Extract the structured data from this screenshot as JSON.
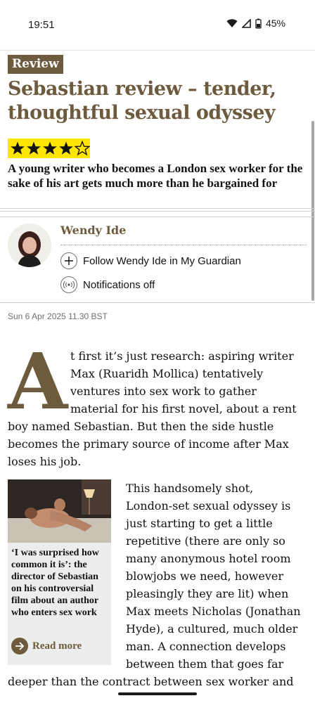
{
  "status_bar": {
    "time": "19:51",
    "battery": "45%"
  },
  "article": {
    "kicker": "Review",
    "headline": "Sebastian review – tender, thoughtful sexual odyssey",
    "rating": {
      "stars": 4,
      "out_of": 5
    },
    "standfirst": "A young writer who becomes a London sex worker for the sake of his art gets much more than he bargained for",
    "byline": {
      "author": "Wendy Ide",
      "follow_label": "Follow Wendy Ide in My Guardian",
      "notifications_label": "Notifications off"
    },
    "dateline": "Sun 6 Apr 2025 11.30 BST",
    "drop_cap": "A",
    "para1_lines": [
      "t first it’s just research: aspiring writer",
      "Max (Ruaridh Mollica) tentatively",
      "ventures into sex work to gather",
      "material for his first novel, about a rent",
      "boy named Sebastian. But then the side hustle",
      "becomes the primary source of income after Max",
      "loses his job."
    ],
    "para2_lines": [
      "This handsomely shot,",
      "London-set sexual odyssey is",
      "just starting to get a little",
      "repetitive (there are only so",
      "many anonymous hotel room",
      "blowjobs we need, however",
      "pleasingly they are lit) when",
      "Max meets Nicholas (Jonathan",
      "Hyde), a cultured, much older",
      "man. A connection develops",
      "between them that goes far",
      "deeper than the contract between sex worker and"
    ],
    "related_card": {
      "quote": "‘I was surprised how common it is’: the director of Sebastian on his controversial film about an author who enters sex work",
      "link_label": "Read more"
    }
  },
  "colors": {
    "accent": "#6e5b3e",
    "star_background": "#ffe500",
    "text": "#121212"
  },
  "icons": [
    "wifi-icon",
    "signal-icon",
    "battery-icon",
    "star-icon",
    "plus-icon",
    "notification-icon",
    "arrow-right-icon"
  ]
}
